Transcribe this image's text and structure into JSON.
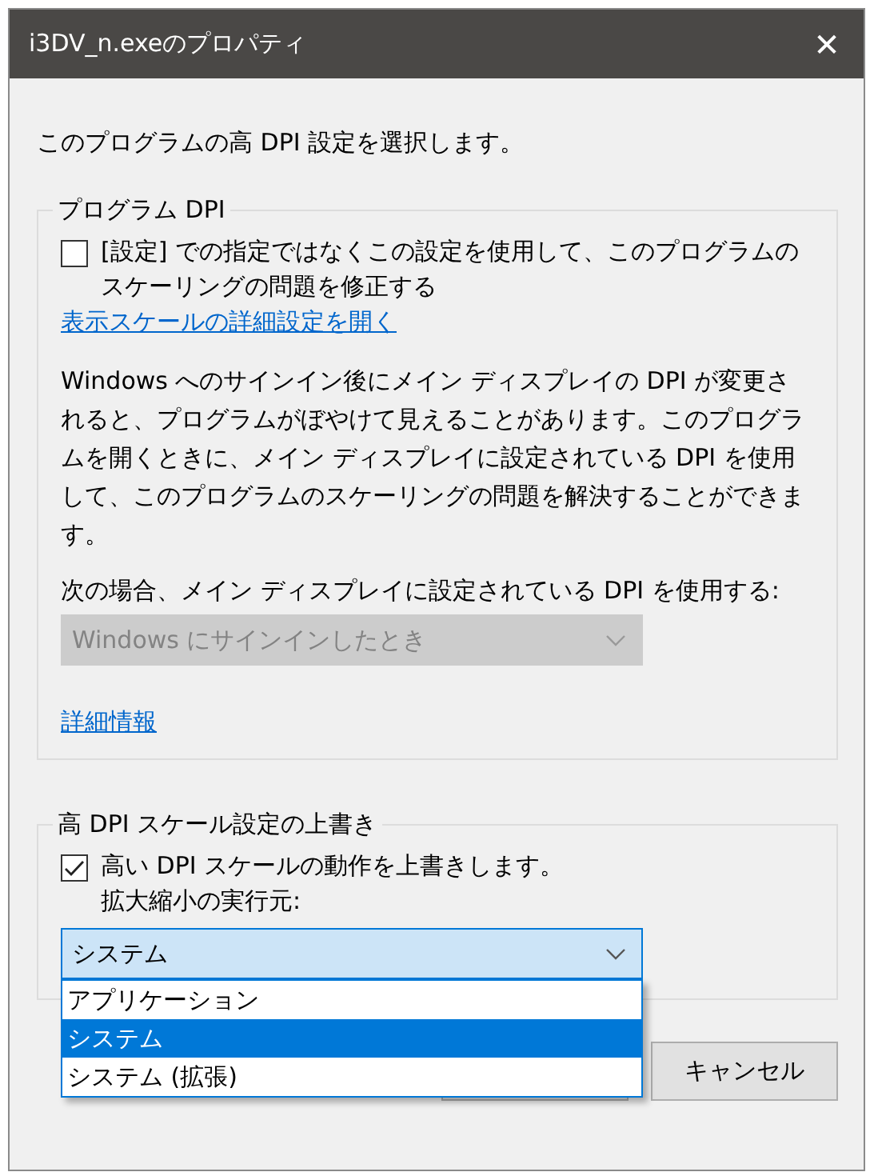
{
  "window": {
    "title": "i3DV_n.exeのプロパティ",
    "close": "✕"
  },
  "intro": "このプログラムの高 DPI 設定を選択します。",
  "program_dpi": {
    "title": "プログラム DPI",
    "checkbox": {
      "label": "[設定] での指定ではなくこの設定を使用して、このプログラムのスケーリングの問題を修正する",
      "checked": false
    },
    "link": "表示スケールの詳細設定を開く",
    "description": "Windows へのサインイン後にメイン ディスプレイの DPI が変更されると、プログラムがぼやけて見えることがあります。このプログラムを開くときに、メイン ディスプレイに設定されている DPI を使用して、このプログラムのスケーリングの問題を解決することができます。",
    "combo_label": "次の場合、メイン ディスプレイに設定されている DPI を使用する:",
    "combo": {
      "value": "Windows にサインインしたとき",
      "disabled": true
    },
    "more_link": "詳細情報"
  },
  "override": {
    "title": "高 DPI スケール設定の上書き",
    "checkbox": {
      "label": "高い DPI スケールの動作を上書きします。",
      "checked": true
    },
    "sublabel": "拡大縮小の実行元:",
    "combo": {
      "value": "システム",
      "disabled": false,
      "expanded": true,
      "options": [
        {
          "label": "アプリケーション",
          "selected": false
        },
        {
          "label": "システム",
          "selected": true
        },
        {
          "label": "システム (拡張)",
          "selected": false
        }
      ]
    }
  },
  "buttons": [
    {
      "kind": "covered"
    },
    {
      "kind": "normal",
      "label": "キャンセル"
    }
  ]
}
